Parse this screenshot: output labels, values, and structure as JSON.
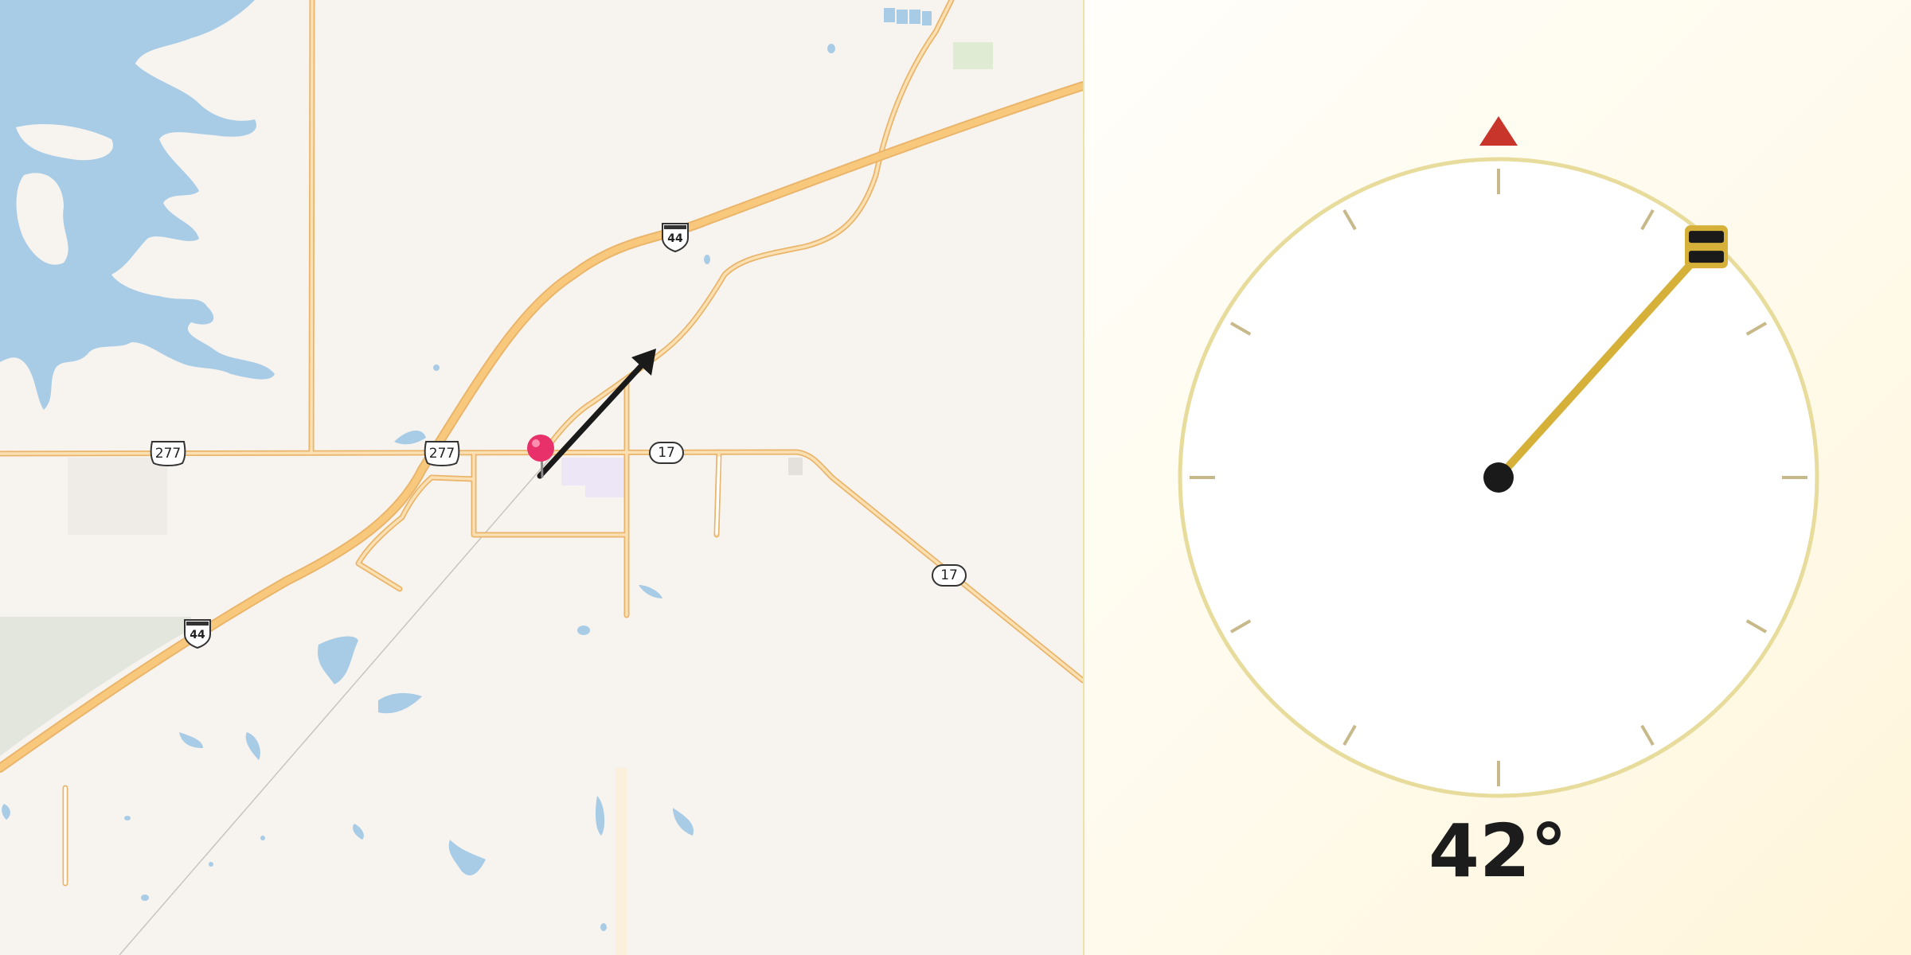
{
  "map": {
    "shields": {
      "i44_north": "44",
      "i44_south": "44",
      "us277_west": "277",
      "us277_east": "277",
      "sh17_town": "17",
      "sh17_east": "17"
    },
    "marker_icon": "map-pin",
    "direction_icon": "arrow",
    "colors": {
      "land": "#f7f4f0",
      "water": "#a9cce6",
      "road": "#f8c97c",
      "road_casing": "#eab56a",
      "marker": "#e8316b",
      "arrow": "#1a1a1a"
    }
  },
  "compass": {
    "bearing_value": 42,
    "bearing_text": "42°",
    "north_icon": "north-triangle",
    "colors": {
      "ring": "#e8dc9c",
      "needle": "#d6b13a",
      "north": "#c8352b",
      "hub": "#1a1a1a"
    }
  }
}
